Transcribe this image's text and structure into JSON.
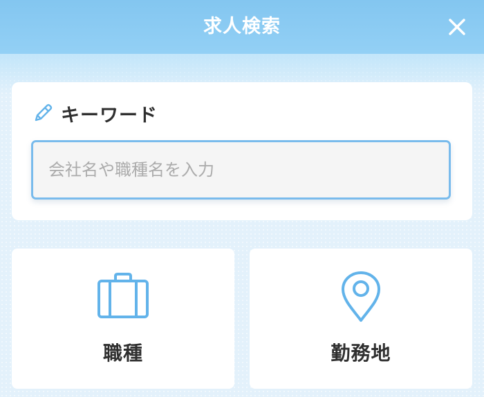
{
  "header": {
    "title": "求人検索",
    "close_icon": "close-icon",
    "background_color": "#8ccbf2"
  },
  "keyword": {
    "label": "キーワード",
    "icon": "pencil-icon",
    "placeholder": "会社名や職種名を入力",
    "value": ""
  },
  "tiles": [
    {
      "label": "職種",
      "icon": "briefcase-icon"
    },
    {
      "label": "勤務地",
      "icon": "map-pin-icon"
    }
  ],
  "colors": {
    "accent": "#62b3ea",
    "input_border": "#79bbec",
    "text": "#2f2f2f",
    "placeholder": "#ababab"
  }
}
